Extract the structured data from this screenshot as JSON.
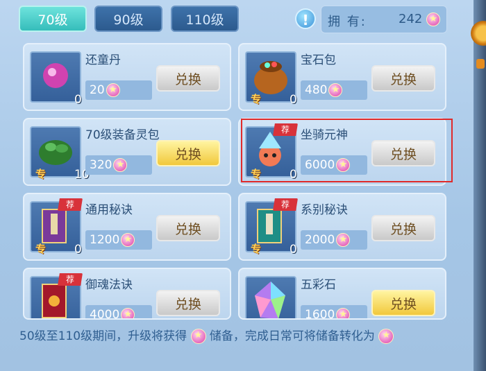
{
  "tabs": [
    {
      "label": "70级",
      "active": true
    },
    {
      "label": "90级",
      "active": false
    },
    {
      "label": "110级",
      "active": false
    }
  ],
  "owned": {
    "label": "拥 有:",
    "value": "242"
  },
  "items": [
    {
      "name": "还童丹",
      "qty": "0",
      "price": "20",
      "button": "兑换",
      "tag": "",
      "special": "",
      "button_style": "gray",
      "icon": "pink-orb-icon"
    },
    {
      "name": "宝石包",
      "qty": "0",
      "price": "480",
      "button": "兑换",
      "tag": "",
      "special": "专",
      "button_style": "gray",
      "icon": "gem-bag-icon"
    },
    {
      "name": "70级装备灵包",
      "qty": "10",
      "price": "320",
      "button": "兑换",
      "tag": "",
      "special": "专",
      "button_style": "yellow",
      "icon": "green-bag-icon"
    },
    {
      "name": "坐骑元神",
      "qty": "0",
      "price": "6000",
      "button": "兑换",
      "tag": "荐",
      "special": "专",
      "button_style": "gray",
      "icon": "mount-spirit-icon"
    },
    {
      "name": "通用秘诀",
      "qty": "0",
      "price": "1200",
      "button": "兑换",
      "tag": "荐",
      "special": "专",
      "button_style": "gray",
      "icon": "purple-book-icon"
    },
    {
      "name": "系别秘诀",
      "qty": "0",
      "price": "2000",
      "button": "兑换",
      "tag": "荐",
      "special": "专",
      "button_style": "gray",
      "icon": "teal-book-icon"
    },
    {
      "name": "御魂法诀",
      "qty": "",
      "price": "4000",
      "button": "兑换",
      "tag": "荐",
      "special": "专",
      "button_style": "gray",
      "icon": "red-book-icon"
    },
    {
      "name": "五彩石",
      "qty": "",
      "price": "1600",
      "button": "兑换",
      "tag": "",
      "special": "",
      "button_style": "yellow",
      "icon": "rainbow-crystal-icon"
    }
  ],
  "footer": {
    "text_a": "50级至110级期间，升级将获得",
    "text_b": "储备，完成日常可将储备转化为"
  },
  "colors": {
    "highlight": "#e02a2a",
    "tab_active": "#35bdbb"
  }
}
